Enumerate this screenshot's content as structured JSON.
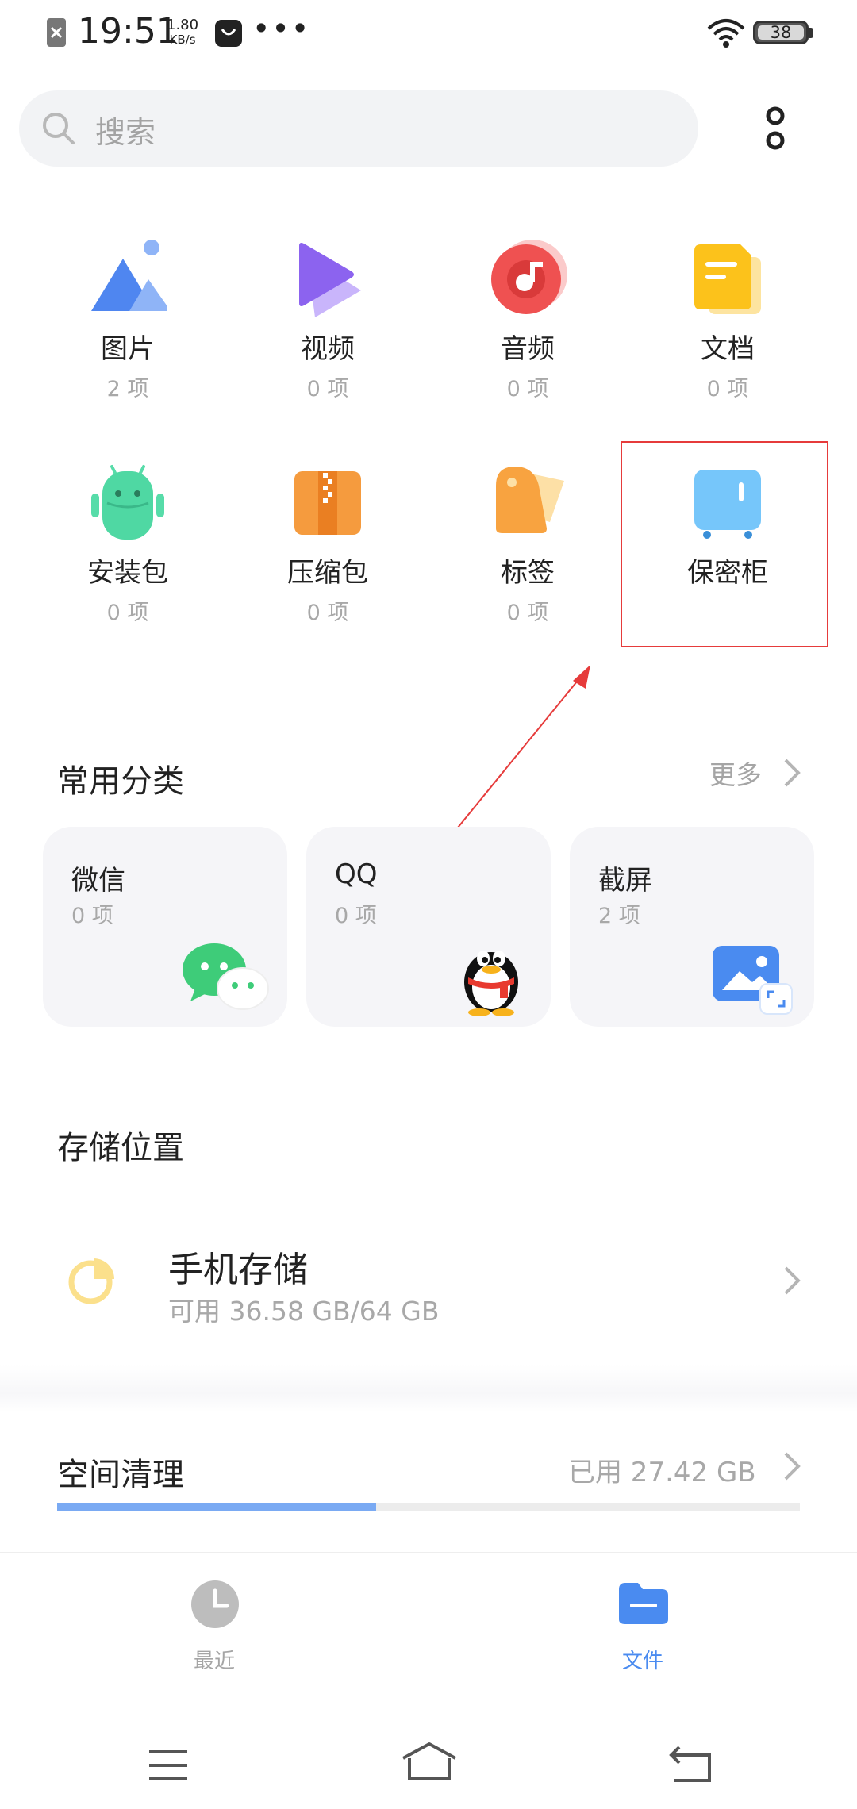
{
  "status_bar": {
    "time": "19:51",
    "speed_value": "1.80",
    "speed_unit": "KB/s",
    "more": "•••",
    "battery": "38"
  },
  "search": {
    "placeholder": "搜索"
  },
  "categories": [
    {
      "label": "图片",
      "count": "2 项",
      "icon": "image-icon"
    },
    {
      "label": "视频",
      "count": "0 项",
      "icon": "video-icon"
    },
    {
      "label": "音频",
      "count": "0 项",
      "icon": "audio-icon"
    },
    {
      "label": "文档",
      "count": "0 项",
      "icon": "document-icon"
    },
    {
      "label": "安装包",
      "count": "0 项",
      "icon": "android-icon"
    },
    {
      "label": "压缩包",
      "count": "0 项",
      "icon": "archive-icon"
    },
    {
      "label": "标签",
      "count": "0 项",
      "icon": "tag-icon"
    },
    {
      "label": "保密柜",
      "icon": "safe-icon"
    }
  ],
  "common": {
    "title": "常用分类",
    "more": "更多",
    "cards": [
      {
        "title": "微信",
        "count": "0 项",
        "icon": "wechat-icon"
      },
      {
        "title": "QQ",
        "count": "0 项",
        "icon": "qq-icon"
      },
      {
        "title": "截屏",
        "count": "2 项",
        "icon": "screenshot-icon"
      }
    ]
  },
  "storage": {
    "title": "存储位置",
    "name": "手机存储",
    "available": "可用 36.58 GB/64 GB"
  },
  "cleanup": {
    "title": "空间清理",
    "used": "已用 27.42 GB",
    "used_fraction": 0.43
  },
  "bottom_nav": {
    "recent": "最近",
    "files": "文件"
  },
  "colors": {
    "accent": "#4a8bf0",
    "highlight": "#e63b3b"
  }
}
